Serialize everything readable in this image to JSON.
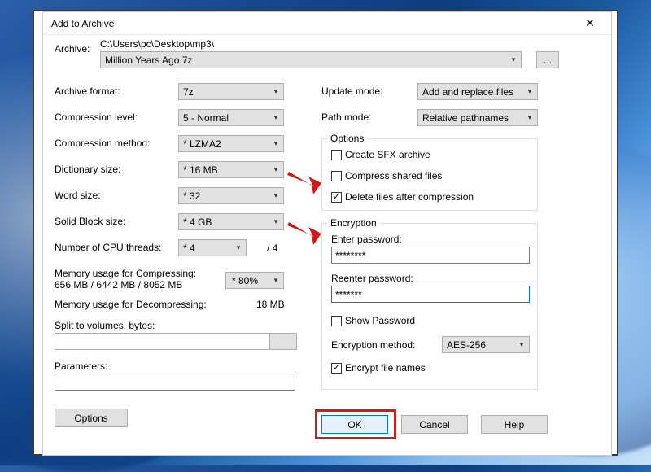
{
  "title": "Add to Archive",
  "archive_label": "Archive:",
  "archive_path": "C:\\Users\\pc\\Desktop\\mp3\\",
  "archive_file": "Million Years Ago.7z",
  "browse_label": "...",
  "left": {
    "format_label": "Archive format:",
    "format_value": "7z",
    "level_label": "Compression level:",
    "level_value": "5 - Normal",
    "method_label": "Compression method:",
    "method_value": "* LZMA2",
    "dict_label": "Dictionary size:",
    "dict_value": "* 16 MB",
    "word_label": "Word size:",
    "word_value": "* 32",
    "block_label": "Solid Block size:",
    "block_value": "* 4 GB",
    "threads_label": "Number of CPU threads:",
    "threads_value": "* 4",
    "threads_total": "/ 4",
    "mem_compress_label": "Memory usage for Compressing:",
    "mem_compress_value": "656 MB / 6442 MB / 8052 MB",
    "mem_pct": "* 80%",
    "mem_decompress_label": "Memory usage for Decompressing:",
    "mem_decompress_value": "18 MB",
    "split_label": "Split to volumes, bytes:",
    "split_value": "",
    "params_label": "Parameters:",
    "params_value": "",
    "options_btn": "Options"
  },
  "right": {
    "update_label": "Update mode:",
    "update_value": "Add and replace files",
    "pathmode_label": "Path mode:",
    "pathmode_value": "Relative pathnames",
    "options_group": "Options",
    "sfx_label": "Create SFX archive",
    "shared_label": "Compress shared files",
    "deleteafter_label": "Delete files after compression",
    "encryption_group": "Encryption",
    "pw1_label": "Enter password:",
    "pw1_value": "********",
    "pw2_label": "Reenter password:",
    "pw2_value": "*******",
    "showpw_label": "Show Password",
    "encmethod_label": "Encryption method:",
    "encmethod_value": "AES-256",
    "encnames_label": "Encrypt file names"
  },
  "buttons": {
    "ok": "OK",
    "cancel": "Cancel",
    "help": "Help"
  }
}
